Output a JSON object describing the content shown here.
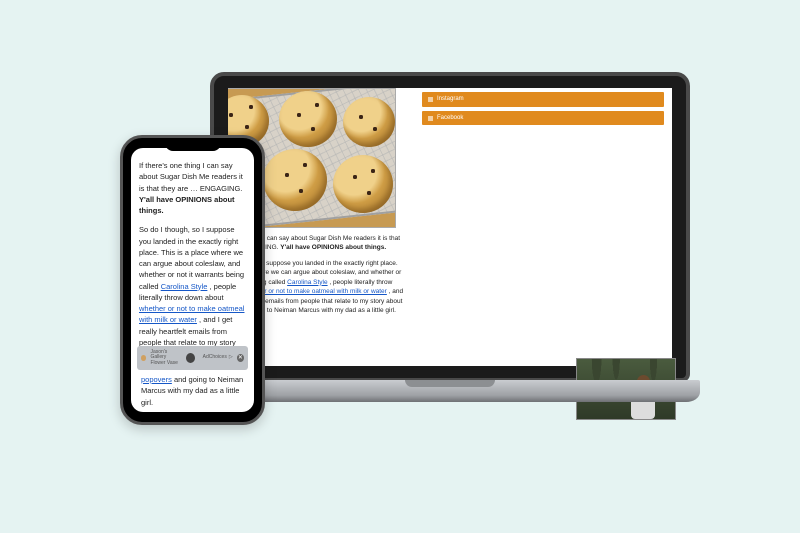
{
  "article": {
    "intro_segments": [
      {
        "plain": "If there's one thing I can say about Sugar Dish Me readers it is that they are … ENGAGING. "
      },
      {
        "bold": "Y'all have OPINIONS about things."
      }
    ],
    "body_segments": [
      {
        "plain": "So do I though, so I suppose you landed in the exactly right place. This is a place where we can argue about coleslaw, and whether or not it warrants being called "
      },
      {
        "link": "Carolina Style"
      },
      {
        "plain": ", people literally throw down about "
      },
      {
        "link": "whether or not to make oatmeal with milk or water"
      },
      {
        "plain": ", and I get really heartfelt emails from people that relate to my story about "
      },
      {
        "link": "popovers"
      },
      {
        "plain": " and going to Neiman Marcus with my dad as a little girl."
      }
    ]
  },
  "sidebar": {
    "items": [
      {
        "label": "Instagram"
      },
      {
        "label": "Facebook"
      }
    ]
  },
  "ad": {
    "brand_top": "Jason's Gallery",
    "brand_bottom": "Flower Vase",
    "provider": "AdChoices"
  }
}
